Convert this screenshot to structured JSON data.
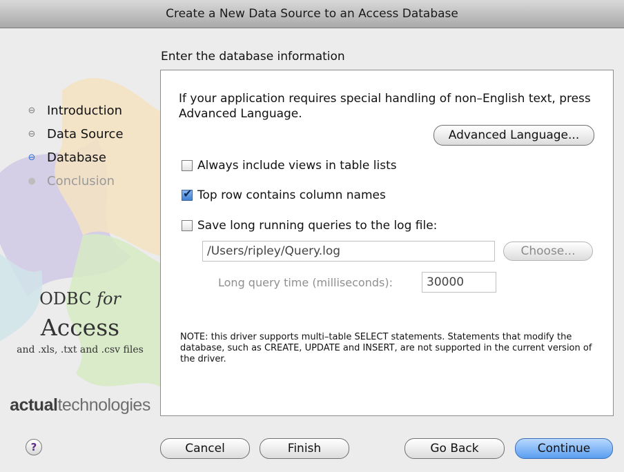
{
  "window": {
    "title": "Create a New Data Source to an Access Database"
  },
  "sidebar": {
    "steps": [
      {
        "label": "Introduction",
        "state": "done"
      },
      {
        "label": "Data Source",
        "state": "done"
      },
      {
        "label": "Database",
        "state": "active"
      },
      {
        "label": "Conclusion",
        "state": "disabled"
      }
    ],
    "brand": {
      "odbc": "ODBC",
      "for": "for",
      "access": "Access",
      "sub": "and .xls, .txt and .csv files",
      "company_bold": "actual",
      "company_rest": "technologies"
    }
  },
  "main": {
    "heading": "Enter the database information",
    "info_text": "If your application requires special handling of non–English text, press Advanced Language.",
    "advanced_language_button": "Advanced Language...",
    "options": [
      {
        "label": "Always include views in table lists",
        "checked": false
      },
      {
        "label": "Top row contains column names",
        "checked": true
      },
      {
        "label": "Save long running queries to the log file:",
        "checked": false
      }
    ],
    "log_path": "/Users/ripley/Query.log",
    "choose_button": "Choose...",
    "query_time_label": "Long query time (milliseconds):",
    "query_time_value": "30000",
    "note": "NOTE:  this driver supports multi–table SELECT statements. Statements that modify the database, such as CREATE, UPDATE and INSERT, are not supported in the current version of the driver."
  },
  "footer": {
    "help_icon": "question-mark-icon",
    "help_label": "?",
    "cancel": "Cancel",
    "finish": "Finish",
    "go_back": "Go Back",
    "continue": "Continue"
  },
  "colors": {
    "accent": "#5a9ef0",
    "active_step": "#2a6fd1"
  }
}
